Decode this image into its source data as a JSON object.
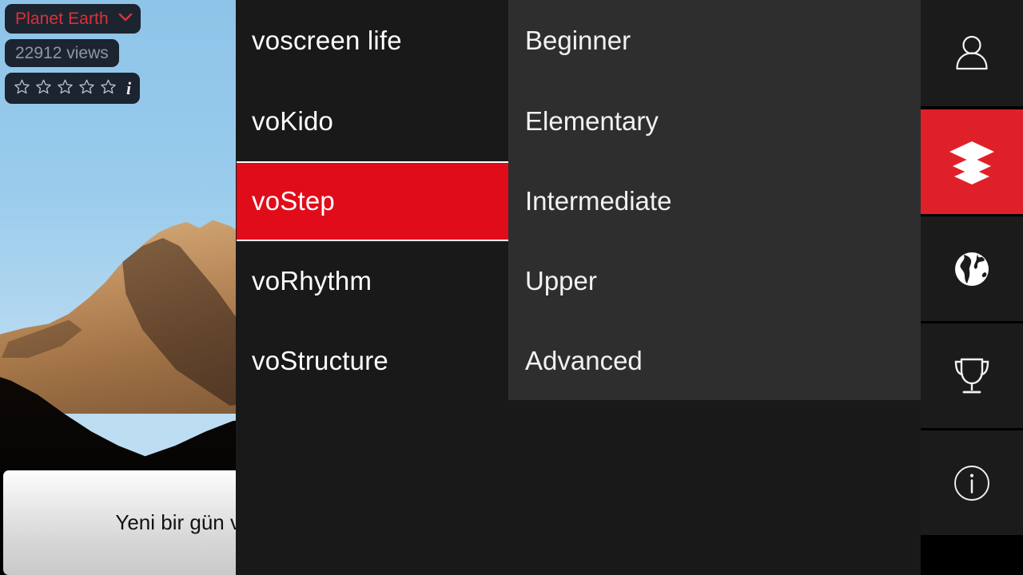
{
  "video": {
    "title_badge": {
      "label": "Planet Earth",
      "icon": "chevron-down-icon",
      "text_color": "#d8323c",
      "bg_color": "#1c2430"
    },
    "views_badge": {
      "label": "22912 views",
      "text_color": "#8e97a1"
    },
    "rating_badge": {
      "stars_total": 5,
      "stars_filled": 0,
      "star_icon": "star-outline-icon",
      "info_icon": "info-italic-icon"
    },
    "caption": {
      "text": "Yeni bir gün v"
    }
  },
  "menu": {
    "column1": {
      "items": [
        {
          "label": "voscreen life",
          "selected": false
        },
        {
          "label": "voKido",
          "selected": false
        },
        {
          "label": "voStep",
          "selected": true
        },
        {
          "label": "voRhythm",
          "selected": false
        },
        {
          "label": "voStructure",
          "selected": false
        }
      ]
    },
    "column2": {
      "items": [
        {
          "label": "Beginner",
          "selected": false
        },
        {
          "label": "Elementary",
          "selected": false
        },
        {
          "label": "Intermediate",
          "selected": false
        },
        {
          "label": "Upper",
          "selected": false
        },
        {
          "label": "Advanced",
          "selected": false
        }
      ]
    }
  },
  "sidebar": {
    "items": [
      {
        "icon": "person-icon",
        "active": false
      },
      {
        "icon": "layers-icon",
        "active": true
      },
      {
        "icon": "globe-icon",
        "active": false
      },
      {
        "icon": "trophy-icon",
        "active": false
      },
      {
        "icon": "info-circle-icon",
        "active": false
      }
    ]
  },
  "colors": {
    "accent_red": "#e00c19",
    "sidebar_active_red": "#e02029",
    "menu_col1_bg": "#191919",
    "menu_col2_bg": "#2e2e2e",
    "sidebar_tile_bg": "#1b1b1b"
  }
}
